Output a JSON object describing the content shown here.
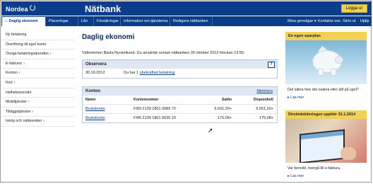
{
  "header": {
    "logo_text": "Nordea",
    "app_name": "Nätbank",
    "logout_label": "Logga ut"
  },
  "nav": {
    "home_icon": "house-icon",
    "tabs": [
      {
        "label": "Daglig ekonomi",
        "active": true
      },
      {
        "label": "Placeringar",
        "active": false
      },
      {
        "label": "Lån",
        "active": false
      },
      {
        "label": "Försäkringar",
        "active": false
      },
      {
        "label": "Information om tjänsterna",
        "active": false
      },
      {
        "label": "Redigera nätbanken",
        "active": false
      }
    ],
    "right_links": [
      "Mina genvägar ▾",
      "Kontakta oss",
      "Skriv ut",
      "Hjälp"
    ]
  },
  "sidebar": {
    "items": [
      {
        "label": "Ny betalning",
        "has_arrow": false
      },
      {
        "label": "Överföring till eget konto",
        "has_arrow": false
      },
      {
        "label": "Övriga betalningsärenden",
        "has_arrow": true
      },
      {
        "label": "E-fakturor",
        "has_arrow": true
      },
      {
        "label": "Konton",
        "has_arrow": true
      },
      {
        "label": "Kort",
        "has_arrow": true
      },
      {
        "label": "Helhetsöversikt",
        "has_arrow": false
      },
      {
        "label": "Mobiltjänster",
        "has_arrow": true
      },
      {
        "label": "Tilläggstjänster",
        "has_arrow": true
      },
      {
        "label": "Inköp och nätärenden",
        "has_arrow": true
      }
    ]
  },
  "main": {
    "title": "Daglig ekonomi",
    "welcome": "Välkommen  Basta Nyckelkund. Du använde senast nätbanken 30 oktober 2012 klockan 13:55.",
    "observe": {
      "title": "Observera",
      "help_icon": "question-icon",
      "date": "30.10.2012",
      "message_prefix": "Du har 1 ",
      "message_link": "obekräftad betalning"
    },
    "accounts": {
      "title": "Konton",
      "minimize_label": "Minimera",
      "headers": {
        "name": "Namn",
        "number": "Kontonummer",
        "balance": "Saldo",
        "available": "Disponibelt"
      },
      "rows": [
        {
          "name": "Brukskonto",
          "number": "FI83 2139 1801 0089 72",
          "balance": "5.631,20+",
          "available": "5.651,20+"
        },
        {
          "name": "Brukskonto",
          "number": "FI46 2139 1801 0635 10",
          "balance": "175,08+",
          "available": "175,08+"
        }
      ]
    }
  },
  "promos": [
    {
      "title": "En egen sparplan",
      "text": "Det säkra fore det osäkra eller allt på spel?",
      "more": "▸ Läs mer"
    },
    {
      "title": "Direktdebiteringen upphör 31.1.2014",
      "text": "Var beredd, övergå till e-faktura.",
      "more": "▸ Läs mer"
    }
  ],
  "colors": {
    "brand_blue": "#0a3d8a",
    "logout_yellow": "#f1d349",
    "promo_yellow": "#f2d255",
    "box_header": "#dfe7f3"
  }
}
